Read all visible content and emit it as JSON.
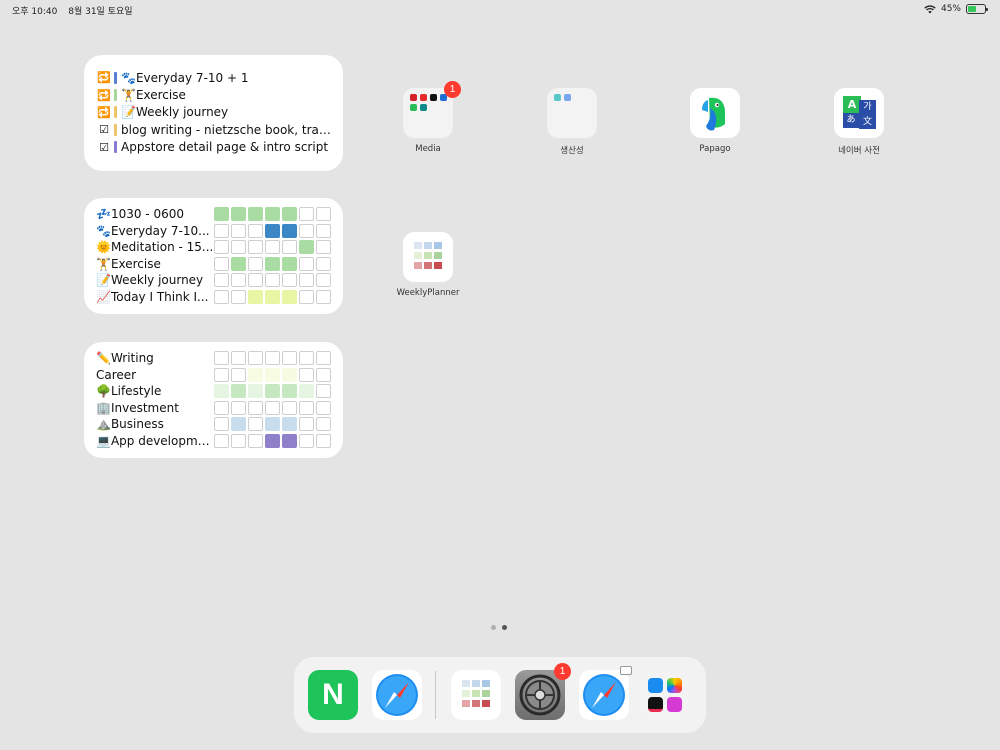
{
  "status": {
    "time": "오후 10:40",
    "date": "8월 31일 토요일",
    "battery": "45%"
  },
  "todo_widget": {
    "items": [
      {
        "icon": "🔁",
        "bar_color": "#5a7dd6",
        "text": "🐾Everyday 7-10 + 1"
      },
      {
        "icon": "🔁",
        "bar_color": "#a6d79b",
        "text": "🏋️Exercise"
      },
      {
        "icon": "🔁",
        "bar_color": "#f0c36a",
        "text": "📝Weekly journey"
      },
      {
        "icon": "☑",
        "bar_color": "#f0c36a",
        "text": "blog writing - nietzsche book, travel m..."
      },
      {
        "icon": "☑",
        "bar_color": "#8a7bd3",
        "text": "Appstore detail page & intro script"
      }
    ]
  },
  "habit_widget": {
    "rows": [
      {
        "label": "💤1030 - 0600",
        "cells": [
          "#a9dca3",
          "#a9dca3",
          "#a9dca3",
          "#a9dca3",
          "#a9dca3",
          "",
          ""
        ]
      },
      {
        "label": "🐾Everyday 7-10...",
        "cells": [
          "",
          "",
          "",
          "#3b86c4",
          "#3b86c4",
          "",
          ""
        ]
      },
      {
        "label": "🌞Meditation - 15...",
        "cells": [
          "",
          "",
          "",
          "",
          "",
          "#a9dca3",
          ""
        ]
      },
      {
        "label": "🏋️Exercise",
        "cells": [
          "",
          "#a9dca3",
          "",
          "#a9dca3",
          "#a9dca3",
          "",
          ""
        ]
      },
      {
        "label": "📝Weekly journey",
        "cells": [
          "",
          "",
          "",
          "",
          "",
          "",
          ""
        ]
      },
      {
        "label": "📈Today I Think I...",
        "cells": [
          "",
          "",
          "#e8f5a3",
          "#e8f5a3",
          "#e8f5a3",
          "",
          ""
        ]
      }
    ]
  },
  "category_widget": {
    "rows": [
      {
        "label": "✏️Writing",
        "cells": [
          "",
          "",
          "",
          "",
          "",
          "",
          ""
        ]
      },
      {
        "label": "Career",
        "cells": [
          "",
          "",
          "#f6fbe2",
          "#f6fbe2",
          "#f6fbe2",
          "",
          ""
        ]
      },
      {
        "label": "🌳Lifestyle",
        "cells": [
          "#e6f5e2",
          "#c6e8c1",
          "#e6f5e2",
          "#c6e8c1",
          "#c6e8c1",
          "#e6f5e2",
          ""
        ]
      },
      {
        "label": "🏢Investment",
        "cells": [
          "",
          "",
          "",
          "",
          "",
          "",
          ""
        ]
      },
      {
        "label": "⛰️Business",
        "cells": [
          "",
          "#c7dcec",
          "",
          "#c7dcec",
          "#c7dcec",
          "",
          ""
        ]
      },
      {
        "label": "💻App development",
        "cells": [
          "",
          "",
          "",
          "#8e80c9",
          "#8e80c9",
          "",
          ""
        ]
      }
    ]
  },
  "apps": {
    "media": {
      "name": "Media",
      "badge": "1"
    },
    "productivity": {
      "name": "생산성"
    },
    "papago": {
      "name": "Papago"
    },
    "naver_dict": {
      "name": "네이버 사전",
      "glyph_a": "A",
      "glyph_ga": "가",
      "glyph_jp": "あ",
      "glyph_mun": "文"
    },
    "weekly_planner": {
      "name": "WeeklyPlanner"
    }
  },
  "dock": {
    "naver": {
      "glyph": "N"
    },
    "settings_badge": "1"
  }
}
